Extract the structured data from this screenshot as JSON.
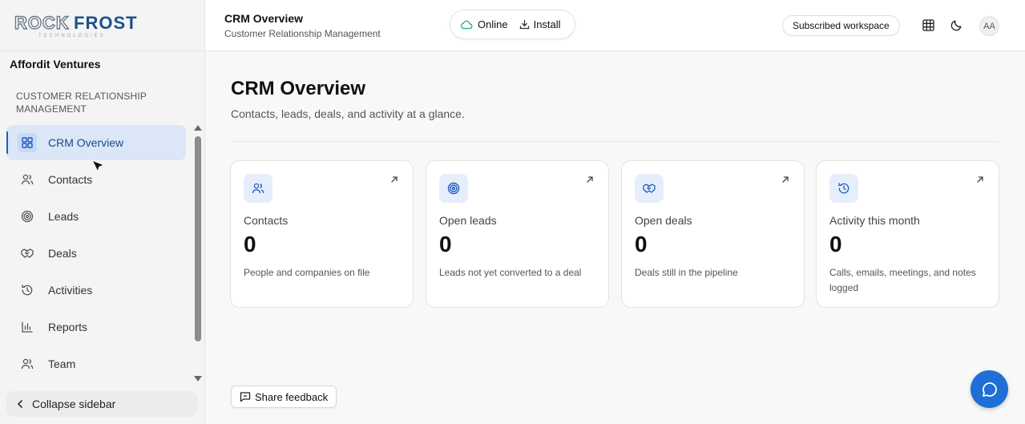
{
  "brand": {
    "logo_text": "ROCK FROST",
    "logo_tagline": "TECHNOLOGIES"
  },
  "sidebar": {
    "org_name": "Affordit Ventures",
    "section_title": "CUSTOMER RELATIONSHIP MANAGEMENT",
    "items": [
      {
        "label": "CRM Overview",
        "icon": "grid-icon",
        "active": true
      },
      {
        "label": "Contacts",
        "icon": "users-icon"
      },
      {
        "label": "Leads",
        "icon": "target-icon"
      },
      {
        "label": "Deals",
        "icon": "handshake-icon"
      },
      {
        "label": "Activities",
        "icon": "history-icon"
      },
      {
        "label": "Reports",
        "icon": "bar-chart-icon"
      },
      {
        "label": "Team",
        "icon": "users-icon"
      }
    ],
    "collapse_label": "Collapse sidebar"
  },
  "header": {
    "title": "CRM Overview",
    "subtitle": "Customer Relationship Management",
    "status_label": "Online",
    "install_label": "Install",
    "subscribed_label": "Subscribed workspace",
    "avatar_initials": "AA"
  },
  "main": {
    "title": "CRM Overview",
    "subtitle": "Contacts, leads, deals, and activity at a glance.",
    "cards": [
      {
        "label": "Contacts",
        "value": "0",
        "desc": "People and companies on file",
        "icon": "users-icon"
      },
      {
        "label": "Open leads",
        "value": "0",
        "desc": "Leads not yet converted to a deal",
        "icon": "target-icon"
      },
      {
        "label": "Open deals",
        "value": "0",
        "desc": "Deals still in the pipeline",
        "icon": "handshake-icon"
      },
      {
        "label": "Activity this month",
        "value": "0",
        "desc": "Calls, emails, meetings, and notes logged",
        "icon": "history-icon"
      }
    ],
    "feedback_label": "Share feedback"
  },
  "colors": {
    "accent": "#1d5bbf",
    "active_bg": "#dbe7f7",
    "chat_button": "#1f6fd6",
    "online": "#1aa86b"
  }
}
